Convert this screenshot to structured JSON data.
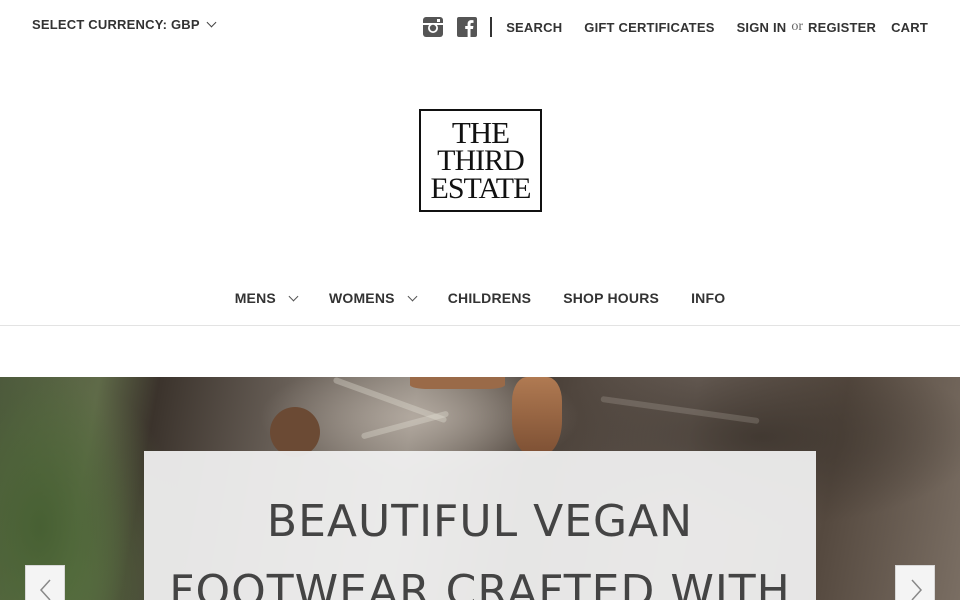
{
  "header": {
    "currency_label": "SELECT CURRENCY: GBP",
    "social": [
      "instagram-icon",
      "facebook-icon"
    ],
    "links": {
      "search": "SEARCH",
      "gift": "GIFT CERTIFICATES",
      "sign_in": "SIGN IN",
      "or": "or",
      "register": "REGISTER",
      "cart": "CART"
    }
  },
  "logo": {
    "line1": "THE",
    "line2": "THIRD",
    "line3": "ESTATE"
  },
  "nav": {
    "items": [
      {
        "label": "MENS",
        "has_dropdown": true
      },
      {
        "label": "WOMENS",
        "has_dropdown": true
      },
      {
        "label": "CHILDRENS",
        "has_dropdown": false
      },
      {
        "label": "SHOP HOURS",
        "has_dropdown": false
      },
      {
        "label": "INFO",
        "has_dropdown": false
      }
    ]
  },
  "hero": {
    "title_line1": "BEAUTIFUL VEGAN",
    "title_line2": "FOOTWEAR CRAFTED WITH",
    "prev_icon": "chevron-left-icon",
    "next_icon": "chevron-right-icon"
  }
}
